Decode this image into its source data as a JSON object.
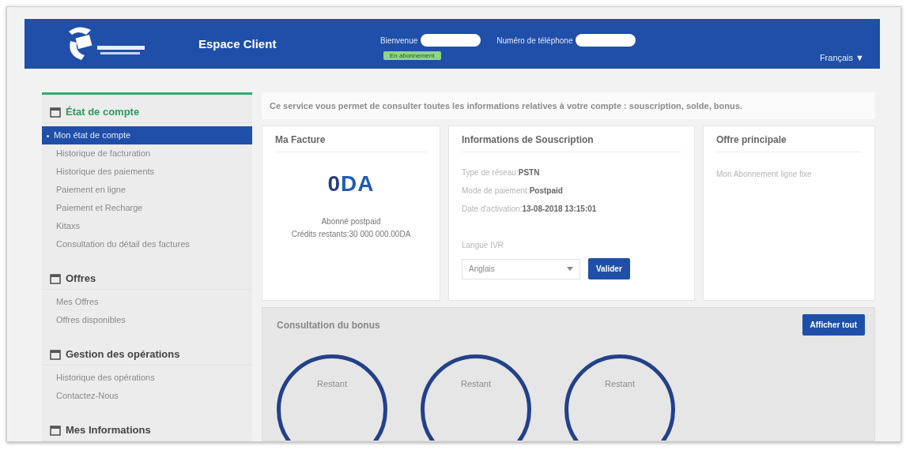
{
  "header": {
    "title": "Espace Client",
    "welcome_label": "Bienvenue",
    "phone_label": "Numéro de téléphone",
    "status_badge": "En abonnement",
    "language": "Français ▼"
  },
  "sidebar": {
    "sections": [
      {
        "title": "État de compte",
        "selected": true,
        "items": [
          {
            "label": "Mon état de compte",
            "selected": true
          },
          {
            "label": "Historique de facturation",
            "selected": false
          },
          {
            "label": "Historique des paiements",
            "selected": false
          },
          {
            "label": "Paiement en ligne",
            "selected": false
          },
          {
            "label": "Paiement et Recharge",
            "selected": false
          },
          {
            "label": "Kitaxs",
            "selected": false
          },
          {
            "label": "Consultation du détail des factures",
            "selected": false
          }
        ]
      },
      {
        "title": "Offres",
        "selected": false,
        "items": [
          {
            "label": "Mes Offres",
            "selected": false
          },
          {
            "label": "Offres disponibles",
            "selected": false
          }
        ]
      },
      {
        "title": "Gestion des opérations",
        "selected": false,
        "items": [
          {
            "label": "Historique des opérations",
            "selected": false
          },
          {
            "label": "Contactez-Nous",
            "selected": false
          }
        ]
      },
      {
        "title": "Mes Informations",
        "selected": false
      }
    ]
  },
  "intro": "Ce service vous permet de consulter toutes les informations relatives à votre compte : souscription, solde, bonus.",
  "invoice": {
    "title": "Ma Facture",
    "amount_number": "0",
    "amount_currency": "DA",
    "subscriber_type": "Abonné postpaid",
    "credit": "Crédits restants:30 000 000.00DA"
  },
  "subscription": {
    "title": "Informations de Souscription",
    "fields": [
      {
        "label": "Type de réseau:",
        "value": "PSTN"
      },
      {
        "label": "Mode de paiement:",
        "value": "Postpaid"
      },
      {
        "label": "Date d'activation:",
        "value": "13-08-2018 13:15:01"
      }
    ],
    "language_label": "Langue IVR",
    "language_value": "Anglais",
    "submit": "Valider"
  },
  "main_offer": {
    "title": "Offre principale",
    "text": "Mon Abonnement ligne fixe"
  },
  "bonus": {
    "title": "Consultation du bonus",
    "button": "Afficher tout",
    "gauges": [
      {
        "label": "Restant"
      },
      {
        "label": "Restant"
      },
      {
        "label": "Restant"
      }
    ]
  }
}
